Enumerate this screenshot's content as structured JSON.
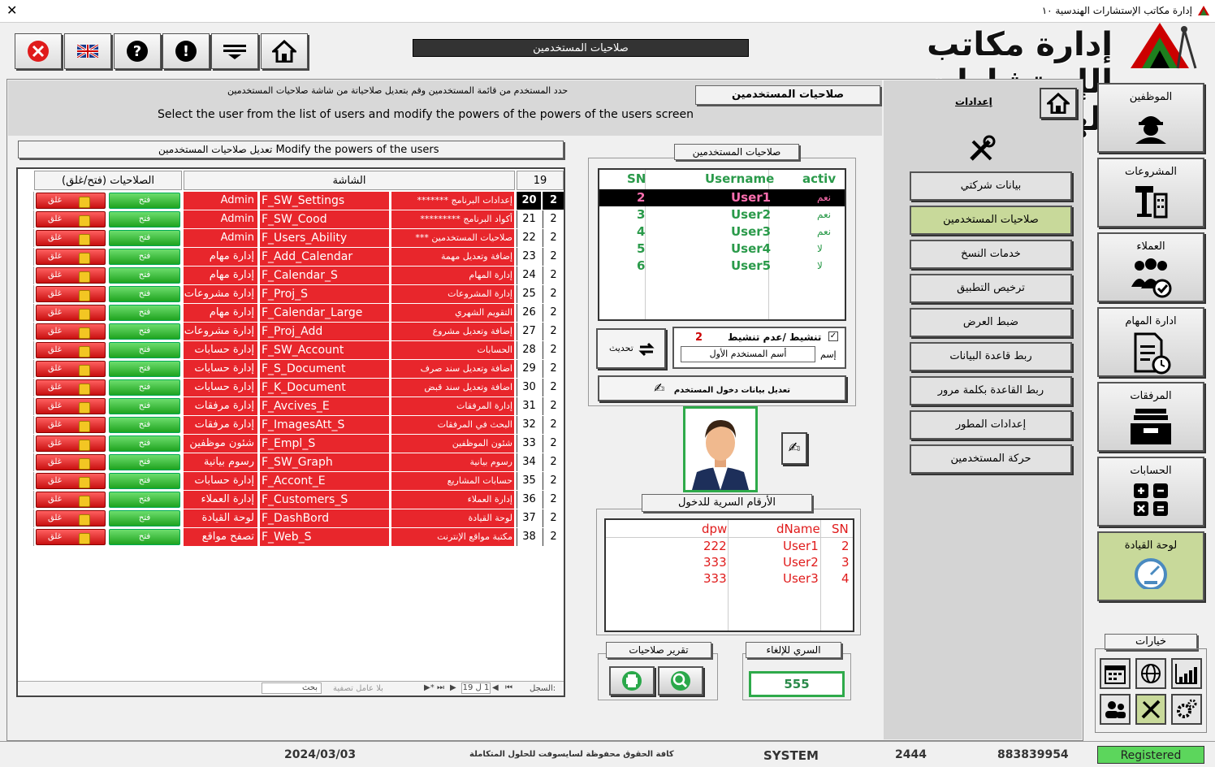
{
  "window": {
    "title": "إدارة مكاتب الإستشارات الهندسية ١٠"
  },
  "header": {
    "screen_title": "صلاحيات المستخدمين",
    "logo_text": "إدارة مكاتب الإستشارات الهندسية"
  },
  "toolbar": {
    "close": "close-icon",
    "lang": "uk-flag-icon",
    "help": "help-icon",
    "info": "info-icon",
    "menu": "menu-icon",
    "home": "home-icon"
  },
  "instructions": {
    "arabic": "حدد المستخدم  من قائمة المستخدمين وقم بتعديل صلاحياتة من شاشة صلاحيات المستخدمين",
    "english": "Select the user from the list of users and modify the powers of the powers of the users screen"
  },
  "section_label": "صلاحيات المستخدمين",
  "settings_link": "إعدادات",
  "grid": {
    "caption_en": "Modify the powers of the users",
    "caption_ar": "تعديل صلاحيات المستخدمين",
    "header_perm": "(فتح/غلق) الصلاحيات",
    "header_screen": "الشاشة",
    "header_count": "19",
    "open_label": "فتح",
    "close_label": "غلق",
    "rows": [
      {
        "owner": "Admin",
        "form": "F_SW_Settings",
        "desc": "إعدادات البرنامج  *******",
        "id": "20",
        "user": "2"
      },
      {
        "owner": "Admin",
        "form": "F_SW_Cood",
        "desc": "أكواد البرنامج  *********",
        "id": "21",
        "user": "2"
      },
      {
        "owner": "Admin",
        "form": "F_Users_Ability",
        "desc": "صلاحيات المستخدمين ***",
        "id": "22",
        "user": "2"
      },
      {
        "owner": "إدارة مهام",
        "form": "F_Add_Calendar",
        "desc": "إضافة وتعديل مهمة",
        "id": "23",
        "user": "2"
      },
      {
        "owner": "إدارة مهام",
        "form": "F_Calendar_S",
        "desc": "إدارة المهام",
        "id": "24",
        "user": "2"
      },
      {
        "owner": "إدارة مشروعات",
        "form": "F_Proj_S",
        "desc": "إدارة المشروعات",
        "id": "25",
        "user": "2"
      },
      {
        "owner": "إدارة مهام",
        "form": "F_Calendar_Large",
        "desc": "التقويم الشهري",
        "id": "26",
        "user": "2"
      },
      {
        "owner": "إدارة مشروعات",
        "form": "F_Proj_Add",
        "desc": "إضافة وتعديل مشروع",
        "id": "27",
        "user": "2"
      },
      {
        "owner": "إدارة حسابات",
        "form": "F_SW_Account",
        "desc": "الحسابات",
        "id": "28",
        "user": "2"
      },
      {
        "owner": "إدارة حسابات",
        "form": "F_S_Document",
        "desc": "اضافة وتعديل سند صرف",
        "id": "29",
        "user": "2"
      },
      {
        "owner": "إدارة حسابات",
        "form": "F_K_Document",
        "desc": "اضافة وتعديل سند قبض",
        "id": "30",
        "user": "2"
      },
      {
        "owner": "إدارة مرفقات",
        "form": "F_Avcives_E",
        "desc": "إدارة المرفقات",
        "id": "31",
        "user": "2"
      },
      {
        "owner": "إدارة مرفقات",
        "form": "F_ImagesAtt_S",
        "desc": "البحث في المرفقات",
        "id": "32",
        "user": "2"
      },
      {
        "owner": "شئون موظفين",
        "form": "F_Empl_S",
        "desc": "شئون الموظفين",
        "id": "33",
        "user": "2"
      },
      {
        "owner": "رسوم بيانية",
        "form": "F_SW_Graph",
        "desc": "رسوم بيانية",
        "id": "34",
        "user": "2"
      },
      {
        "owner": "إدارة حسابات",
        "form": "F_Accont_E",
        "desc": "حسابات المشاريع",
        "id": "35",
        "user": "2"
      },
      {
        "owner": "إدارة العملاء",
        "form": "F_Customers_S",
        "desc": "إدارة العملاء",
        "id": "36",
        "user": "2"
      },
      {
        "owner": "لوحة القيادة",
        "form": "F_DashBord",
        "desc": "لوحة القيادة",
        "id": "37",
        "user": "2"
      },
      {
        "owner": "تصفح مواقع",
        "form": "F_Web_S",
        "desc": "مكتبة مواقع الإنترنت",
        "id": "38",
        "user": "2"
      }
    ],
    "nav": {
      "record_label": "السجل:",
      "position": "1 ل 19",
      "filter": "بلا عامل تصفية",
      "search": "بحث"
    }
  },
  "users_box": {
    "label": "صلاحيات المستخدمين",
    "headers": {
      "sn": "SN",
      "username": "Username",
      "active": "activ"
    },
    "rows": [
      {
        "sn": "2",
        "username": "User1",
        "active": "نعم"
      },
      {
        "sn": "3",
        "username": "User2",
        "active": "نعم"
      },
      {
        "sn": "4",
        "username": "User3",
        "active": "نعم"
      },
      {
        "sn": "5",
        "username": "User4",
        "active": "لا"
      },
      {
        "sn": "6",
        "username": "User5",
        "active": "لا"
      }
    ],
    "refresh": "تحديث",
    "activate_label": "تنشيط /عدم تنشيط",
    "activate_value": "2",
    "name_label": "إسم",
    "name_value": "أسم المستخدم الأول",
    "edit_login": "تعديل بيانات دخول المستخدم"
  },
  "passwords": {
    "label": "الأرقام السرية للدخول",
    "headers": {
      "dpw": "dpw",
      "dname": "dName",
      "sn": "SN"
    },
    "rows": [
      {
        "dpw": "222",
        "dname": "User1",
        "sn": "2"
      },
      {
        "dpw": "333",
        "dname": "User2",
        "sn": "3"
      },
      {
        "dpw": "333",
        "dname": "User3",
        "sn": "4"
      }
    ]
  },
  "report": {
    "label": "تقرير صلاحيات"
  },
  "cancel": {
    "label": "السري للإلغاء",
    "value": "555"
  },
  "side_menu": [
    "بيانات شركتي",
    "صلاحيات المستخدمين",
    "خدمات النسخ",
    "ترخيص التطبيق",
    "ضبط العرض",
    "ربط قاعدة البيانات",
    "ربط القاعدة بكلمة مرور",
    "إعدادات المطور",
    "حركة المستخدمين"
  ],
  "nav": [
    "الموظفين",
    "المشروعات",
    "العملاء",
    "ادارة المهام",
    "المرفقات",
    "الحسابات",
    "لوحة القيادة"
  ],
  "options_label": "خيارات",
  "status": {
    "date": "2024/03/03",
    "rights": "كافة الحقوق محفوظة لسايسوفت للحلول المتكاملة",
    "user": "SYSTEM",
    "code": "2444",
    "serial": "883839954",
    "registered": "Registered"
  }
}
